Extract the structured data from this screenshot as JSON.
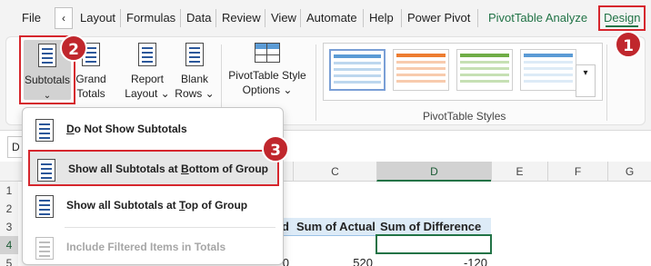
{
  "ribbon_tabs": {
    "file": "File",
    "layout": "Layout",
    "formulas": "Formulas",
    "data": "Data",
    "review": "Review",
    "view": "View",
    "automate": "Automate",
    "help": "Help",
    "power_pivot": "Power Pivot",
    "pivottable_analyze": "PivotTable Analyze",
    "design": "Design",
    "back_glyph": "‹"
  },
  "ribbon": {
    "subtotals": {
      "line1": "Subtotals",
      "line2": "⌄"
    },
    "grand_totals": {
      "line1": "Grand",
      "line2": "Totals ⌄"
    },
    "report_layout": {
      "line1": "Report",
      "line2": "Layout ⌄"
    },
    "blank_rows": {
      "line1": "Blank",
      "line2": "Rows ⌄"
    },
    "pivot_style_options": {
      "line1": "PivotTable Style",
      "line2": "Options ⌄"
    },
    "pivottable_styles_label": "PivotTable Styles",
    "more_glyph": "▾"
  },
  "badges": {
    "b1": "1",
    "b2": "2",
    "b3": "3"
  },
  "menu": {
    "item1_pre": "",
    "item1_u": "D",
    "item1_post": "o Not Show Subtotals",
    "item2_pre": "Show all Subtotals at ",
    "item2_u": "B",
    "item2_post": "ottom of Group",
    "item3_pre": "Show all Subtotals at ",
    "item3_u": "T",
    "item3_post": "op of Group",
    "item4": "Include Filtered Items in Totals"
  },
  "sheet": {
    "namebox": "D",
    "columns": [
      "C",
      "D",
      "E",
      "F",
      "G"
    ],
    "rows": [
      "1",
      "2",
      "3",
      "4",
      "5"
    ],
    "header_partial": "d",
    "sum_actual": "Sum of Actual",
    "sum_difference": "Sum of Difference",
    "row5_b_partial": "0",
    "row5_c": "520",
    "row5_d": "-120"
  },
  "colors": {
    "accent_green": "#217346",
    "highlight_red": "#d6262d",
    "badge_red": "#c0272d",
    "pivot_header_blue": "#ddebf7"
  }
}
